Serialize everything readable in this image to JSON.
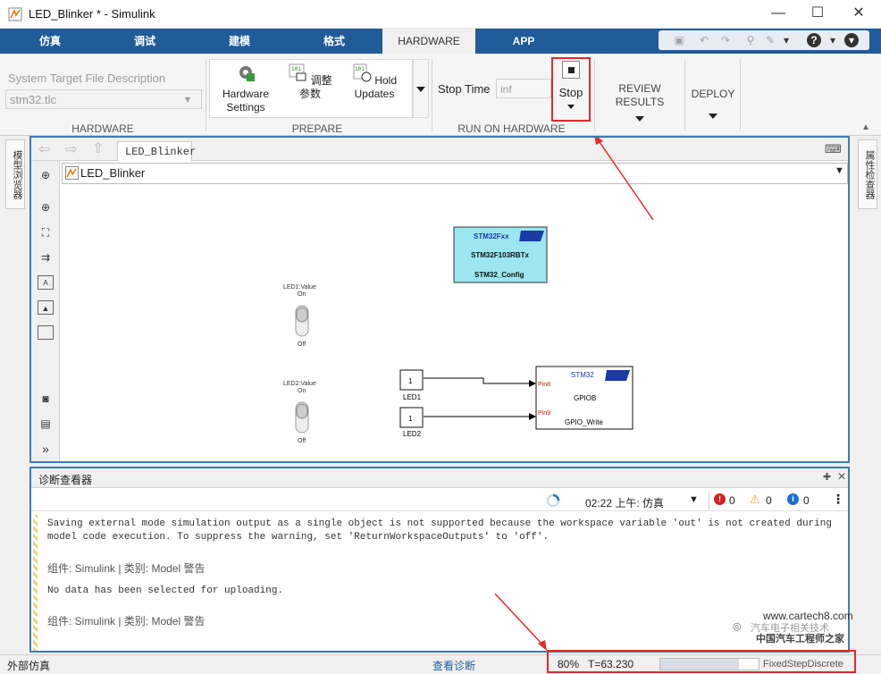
{
  "window": {
    "title": "LED_Blinker * - Simulink",
    "minimize": "—",
    "maximize": "☐",
    "close": "✕"
  },
  "tabs": [
    {
      "label": "仿真"
    },
    {
      "label": "调试"
    },
    {
      "label": "建模"
    },
    {
      "label": "格式"
    },
    {
      "label": "HARDWARE"
    },
    {
      "label": "APP"
    }
  ],
  "toolstrip": {
    "target_file_label": "System Target File Description",
    "target_file_value": "stm32.tlc",
    "hardware_group": "HARDWARE",
    "hardware_settings": "Hardware Settings",
    "tune_params": "调整参数",
    "hold_updates": "Hold Updates",
    "prepare_group": "PREPARE",
    "stop_time_label": "Stop Time",
    "stop_time_value": "inf",
    "stop_button": "Stop",
    "run_group": "RUN ON HARDWARE",
    "review_results": "REVIEW RESULTS",
    "deploy": "DEPLOY"
  },
  "side": {
    "left_tab": "模型浏览器",
    "right_tab": "属性检查器"
  },
  "editor": {
    "tab_label": "LED_Blinker",
    "address": "LED_Blinker"
  },
  "model": {
    "config_block": {
      "title": "STM32Fxx",
      "chip": "STM32F103RBTx",
      "name": "STM32_Config"
    },
    "switch1": {
      "label": "LED1:Value",
      "on": "On",
      "off": "Off"
    },
    "switch2": {
      "label": "LED2:Value",
      "on": "On",
      "off": "Off"
    },
    "const1": {
      "value": "1",
      "name": "LED1"
    },
    "const2": {
      "value": "1",
      "name": "LED2"
    },
    "gpio_block": {
      "title": "STM32",
      "port": "GPIOB",
      "name": "GPIO_Write",
      "pin1": "Pin8",
      "pin2": "Pin9"
    }
  },
  "diagnostics": {
    "title": "诊断查看器",
    "timestamp": "02:22 上午: 仿真",
    "errors": "0",
    "warnings": "0",
    "infos": "0",
    "msg1_line1": "Saving external mode simulation output as a single object is not supported because the workspace variable 'out'  is not created during",
    "msg1_line2": "model code execution. To suppress the warning, set 'ReturnWorkspaceOutputs' to 'off'.",
    "msg1_meta": "组件: Simulink | 类别: Model 警告",
    "msg2_line1": "No data has been selected for uploading.",
    "msg2_meta": "组件: Simulink | 类别: Model 警告"
  },
  "status": {
    "mode": "外部仿真",
    "view_diag": "查看诊断",
    "progress_text": "80%",
    "progress": 0.8,
    "time": "T=63.230",
    "solver": "FixedStepDiscrete"
  },
  "watermark": {
    "text1": "汽车电子相关技术",
    "site": "www.cartech8.com",
    "brand": "中国汽车工程师之家"
  },
  "colors": {
    "accent": "#1f5c99",
    "highlight": "#e52a2a",
    "config_block": "#9be6f0",
    "warning": "#e8a317"
  }
}
